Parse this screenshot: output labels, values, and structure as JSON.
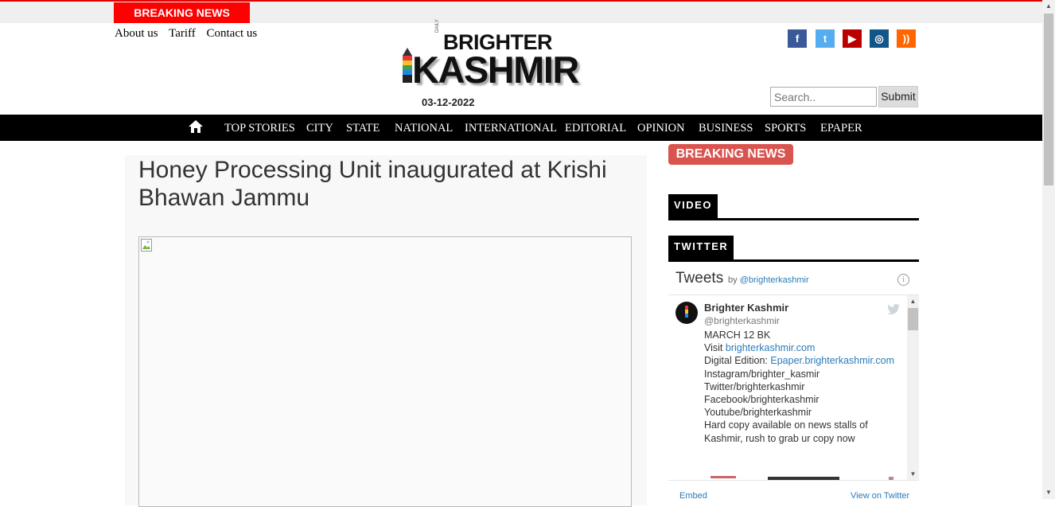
{
  "topbar": {
    "breaking_label": "BREAKING NEWS"
  },
  "toplinks": [
    "About us",
    "Tariff",
    "Contact us"
  ],
  "logo": {
    "line1": "BRIGHTER",
    "line2": "KASHMIR",
    "small": "DAILY"
  },
  "date": "03-12-2022",
  "social": [
    {
      "icon": "facebook-icon",
      "glyph": "f",
      "color": "#3b5998"
    },
    {
      "icon": "twitter-icon",
      "glyph": "t",
      "color": "#55acee"
    },
    {
      "icon": "youtube-icon",
      "glyph": "▶",
      "color": "#bb0000"
    },
    {
      "icon": "instagram-icon",
      "glyph": "◎",
      "color": "#125688"
    },
    {
      "icon": "rss-icon",
      "glyph": "))",
      "color": "#ff6600"
    }
  ],
  "search": {
    "placeholder": "Search..",
    "submit": "Submit"
  },
  "nav": [
    "TOP STORIES",
    "CITY",
    "STATE",
    "NATIONAL",
    "INTERNATIONAL",
    "EDITORIAL",
    "OPINION",
    "BUSINESS",
    "SPORTS",
    "EPAPER"
  ],
  "article": {
    "title": "Honey Processing Unit inaugurated at Krishi Bhawan Jammu"
  },
  "sidebar": {
    "breaking_label": "BREAKING NEWS",
    "video_label": "VIDEO",
    "twitter_label": "TWITTER",
    "widget": {
      "title": "Tweets",
      "by_prefix": "by",
      "by_handle": "@brighterkashmir",
      "tweet": {
        "name": "Brighter Kashmir",
        "handle": "@brighterkashmir",
        "lines": [
          {
            "text": "MARCH 12 BK"
          },
          {
            "prefix": "Visit ",
            "link": "brighterkashmir.com"
          },
          {
            "prefix": "Digital Edition: ",
            "link": "Epaper.brighterkashmir.com"
          },
          {
            "text": "Instagram/brighter_kasmir"
          },
          {
            "text": "Twitter/brighterkashmir"
          },
          {
            "text": "Facebook/brighterkashmir"
          },
          {
            "text": "Youtube/brighterkashmir"
          },
          {
            "text": "Hard copy available on news stalls of"
          },
          {
            "text": "Kashmir, rush to grab ur copy now"
          }
        ]
      },
      "embed": "Embed",
      "view": "View on Twitter"
    }
  },
  "colors": {
    "nav_bg": "#000000",
    "breaking_red": "#ff0000",
    "breaking_button": "#d9534f",
    "link_blue": "#2b7bb9"
  }
}
